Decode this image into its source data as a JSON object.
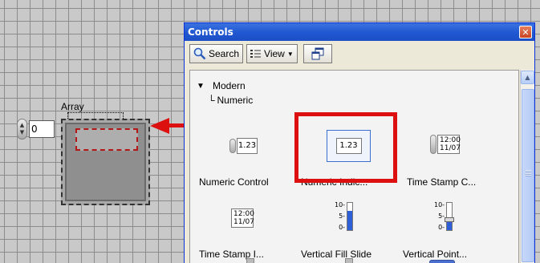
{
  "front_panel": {
    "array_label": "Array",
    "index_value": "0"
  },
  "palette": {
    "title": "Controls",
    "toolbar": {
      "search_label": "Search",
      "view_label": "View"
    },
    "tree": {
      "root": "Modern",
      "child": "Numeric"
    },
    "items": [
      {
        "label": "Numeric Control",
        "icon": "numeric-control-icon",
        "text": "1.23"
      },
      {
        "label": "Numeric Indic...",
        "icon": "numeric-indicator-icon",
        "text": "1.23"
      },
      {
        "label": "Time Stamp C...",
        "icon": "time-stamp-control-icon",
        "text": "12:00 11/07"
      },
      {
        "label": "Time Stamp I...",
        "icon": "time-stamp-indicator-icon",
        "text": "12:00 11/07"
      },
      {
        "label": "Vertical Fill Slide",
        "icon": "vertical-fill-slide-icon",
        "scale": [
          "10-",
          "5-",
          "0-"
        ]
      },
      {
        "label": "Vertical Point...",
        "icon": "vertical-pointer-slide-icon",
        "scale": [
          "10-",
          "5-",
          "0-"
        ]
      }
    ]
  },
  "colors": {
    "highlight": "#dd1010",
    "titlebar": "#2057d1",
    "fill": "#2f5fd6"
  }
}
